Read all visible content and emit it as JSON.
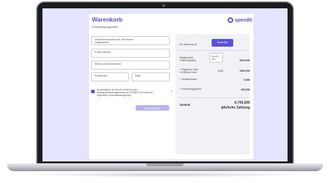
{
  "checkout": {
    "title": "Warenkorb",
    "subtitle": "Preisfestlegungsdetails",
    "brand": {
      "name": "spendit",
      "color": "#5a4ee6"
    },
    "form": {
      "company_field": {
        "label": "Unternehmensname inkl. Rechtsform",
        "value": "Company AG"
      },
      "email_placeholder": "E-Mail-Adresse",
      "street_placeholder": "Straße und Hausnummer",
      "zip_placeholder": "Postleitzahl",
      "city_placeholder": "Stadt",
      "terms_text": "Ich akzeptiere die Spendit GmbH zu einer Auftragsverarbeitungsvertrag der SPENDIT AG sowie die Allgemeine Geschäftsbedingungen",
      "submit_label": "Kostenpflichtig bestellen"
    },
    "summary": {
      "heading": "Ihr Warenkorb",
      "edit_label": "Bearbeiten",
      "items": [
        {
          "label": "Mobility Karte 3.960/Guthaben",
          "qty_label": "Anzahl",
          "qty": "150",
          "price": "3600,00€"
        },
        {
          "label": "+ Physische Karte 10,00€/pro Karte",
          "qty": "x100",
          "price": "1800,00€"
        },
        {
          "label": "+ Versandkosten",
          "price": "5,00€"
        },
        {
          "label": "+ Einrichtungsgebühr",
          "price": "300,00€"
        }
      ],
      "total_label": "Summe",
      "total_value": "6.705,00€",
      "total_note": "jährliche Zahlung"
    }
  }
}
